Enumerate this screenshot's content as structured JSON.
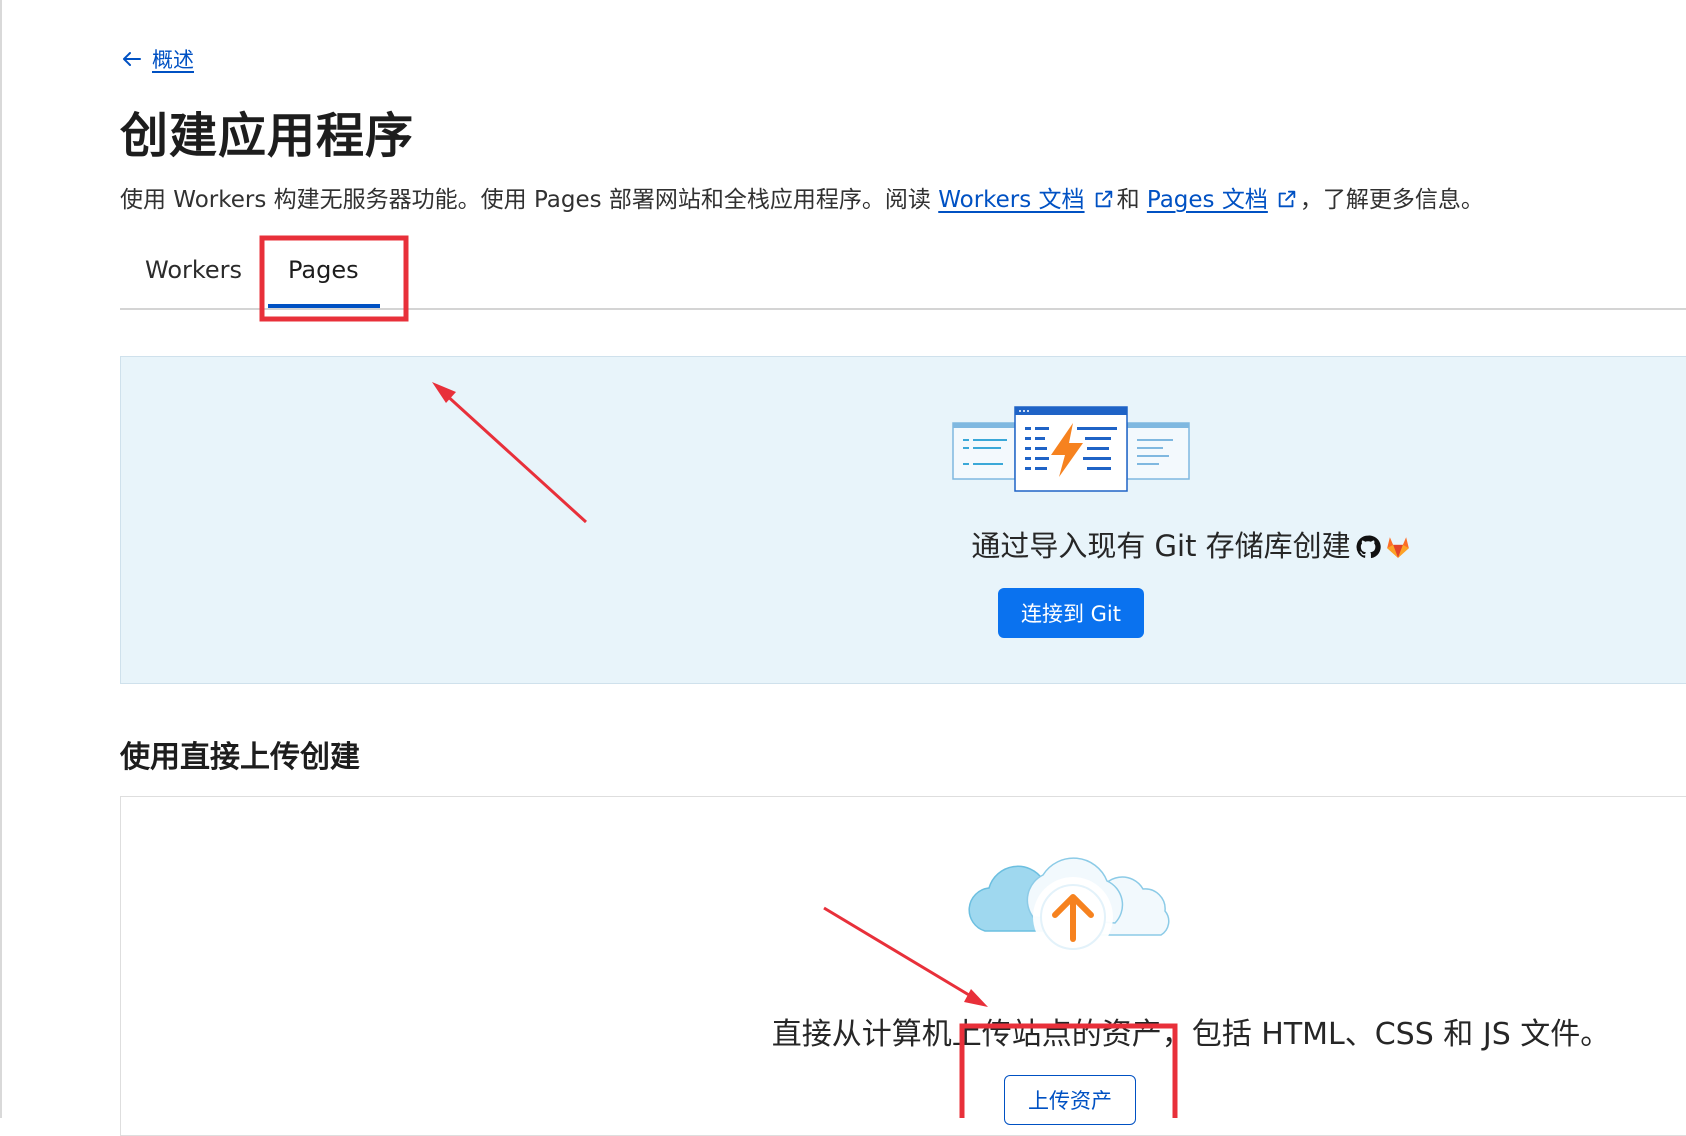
{
  "nav": {
    "back_label": "概述"
  },
  "page": {
    "title": "创建应用程序",
    "description": {
      "part1": "使用 Workers 构建无服务器功能。使用 Pages 部署网站和全栈应用程序。阅读 ",
      "workers_docs_link": "Workers 文档",
      "and": "和 ",
      "pages_docs_link": "Pages 文档",
      "suffix": "，了解更多信息。"
    }
  },
  "tabs": [
    {
      "label": "Workers",
      "selected": false
    },
    {
      "label": "Pages",
      "selected": true
    }
  ],
  "git_section": {
    "heading": "通过导入现有 Git 存储库创建",
    "button_label": "连接到 Git"
  },
  "upload_section": {
    "heading": "使用直接上传创建",
    "text": "直接从计算机上传站点的资产，包括 HTML、CSS 和 JS 文件。",
    "button_label": "上传资产"
  },
  "colors": {
    "accent": "#0051c3",
    "primary_button": "#0a72ef",
    "git_panel_bg": "#e8f4fa",
    "annotation": "#e8303a",
    "lightning": "#f6821f"
  },
  "icons": {
    "back": "arrow-left-icon",
    "external_link": "external-link-icon",
    "github": "github-icon",
    "gitlab": "gitlab-icon",
    "upload": "upload-arrow-icon"
  }
}
